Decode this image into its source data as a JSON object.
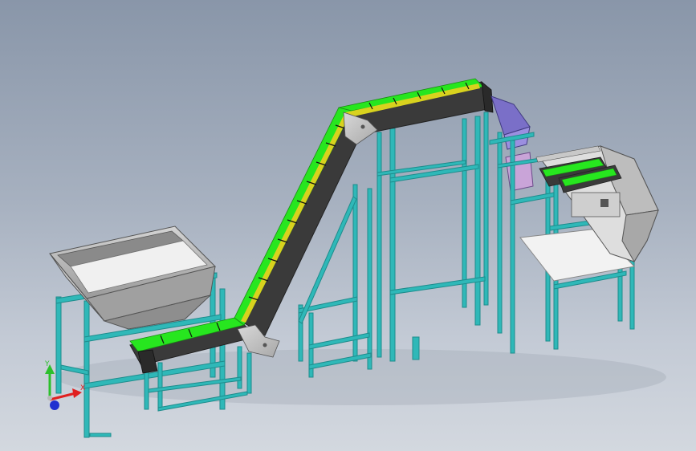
{
  "viewport": {
    "background_top": "#8996a9",
    "background_bottom": "#d3d8df"
  },
  "model": {
    "frame_color": "#2fb8b8",
    "frame_dark": "#1e8c8c",
    "belt_cleat_color": "#27e61f",
    "belt_cleat_alt_color": "#d8d21e",
    "belt_body_color": "#3a3a3a",
    "side_plate_color": "#c4c4c4",
    "hopper_color": "#b9b9b9",
    "chute_color": "#7a6fc8",
    "machine_color": "#dedede"
  },
  "triad": {
    "x_label": "X",
    "y_label": "Y",
    "x_color": "#e02020",
    "y_color": "#2cc02c",
    "z_color": "#2030d0"
  }
}
